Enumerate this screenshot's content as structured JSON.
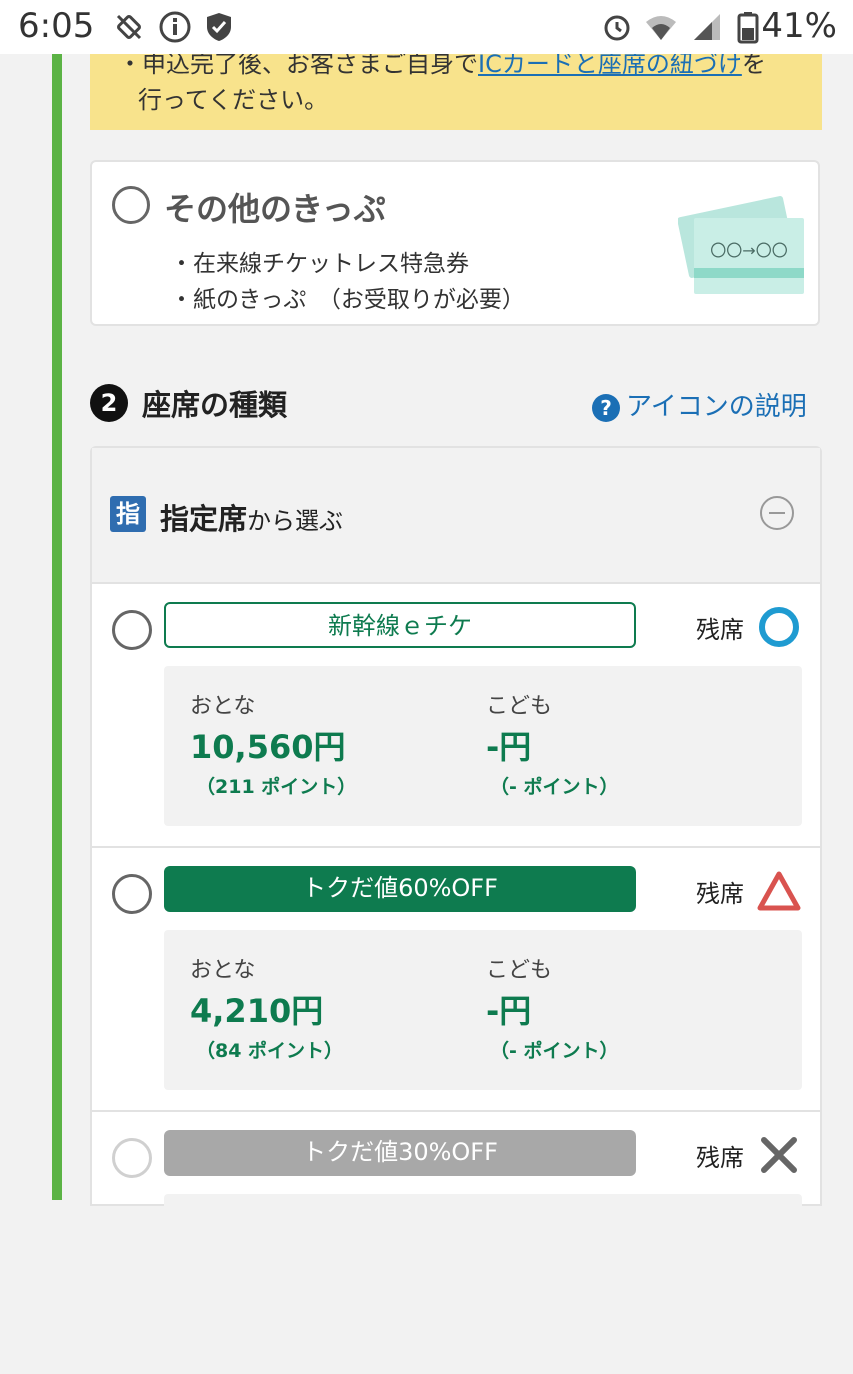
{
  "status_bar": {
    "time": "6:05",
    "battery_percent": "41%",
    "network": "5"
  },
  "notice": {
    "line1_prefix": "・申込完了後、お客さまご自身で",
    "line1_link": "ICカードと座席の紐づけ",
    "line1_suffix": "を",
    "line2": "行ってください。"
  },
  "other_tickets": {
    "title": "その他のきっぷ",
    "bullets": [
      "・在来線チケットレス特急券",
      "・紙のきっぷ　（お受取りが必要）"
    ],
    "illustration_text": "〇〇→〇〇"
  },
  "seat_section": {
    "step": "2",
    "title": "座席の種類",
    "help_icon": "?",
    "help_link": "アイコンの説明",
    "panel": {
      "badge": "指",
      "title": "指定席",
      "title_suffix": "から選ぶ"
    },
    "options": [
      {
        "fare_name": "新幹線ｅチケ",
        "seat_label": "残席",
        "availability": "circle",
        "adult_label": "おとな",
        "adult_price": "10,560円",
        "adult_points": "（211 ポイント）",
        "child_label": "こども",
        "child_price": "-円",
        "child_points": "（- ポイント）"
      },
      {
        "fare_name": "トクだ値60%OFF",
        "seat_label": "残席",
        "availability": "triangle",
        "adult_label": "おとな",
        "adult_price": "4,210円",
        "adult_points": "（84 ポイント）",
        "child_label": "こども",
        "child_price": "-円",
        "child_points": "（- ポイント）"
      },
      {
        "fare_name": "トクだ値30%OFF",
        "seat_label": "残席",
        "availability": "cross"
      }
    ]
  },
  "colors": {
    "accent_green": "#0e7b4f",
    "progress_green": "#5bb345",
    "notice_yellow": "#f8e38c",
    "link_blue": "#1b6fb5"
  }
}
